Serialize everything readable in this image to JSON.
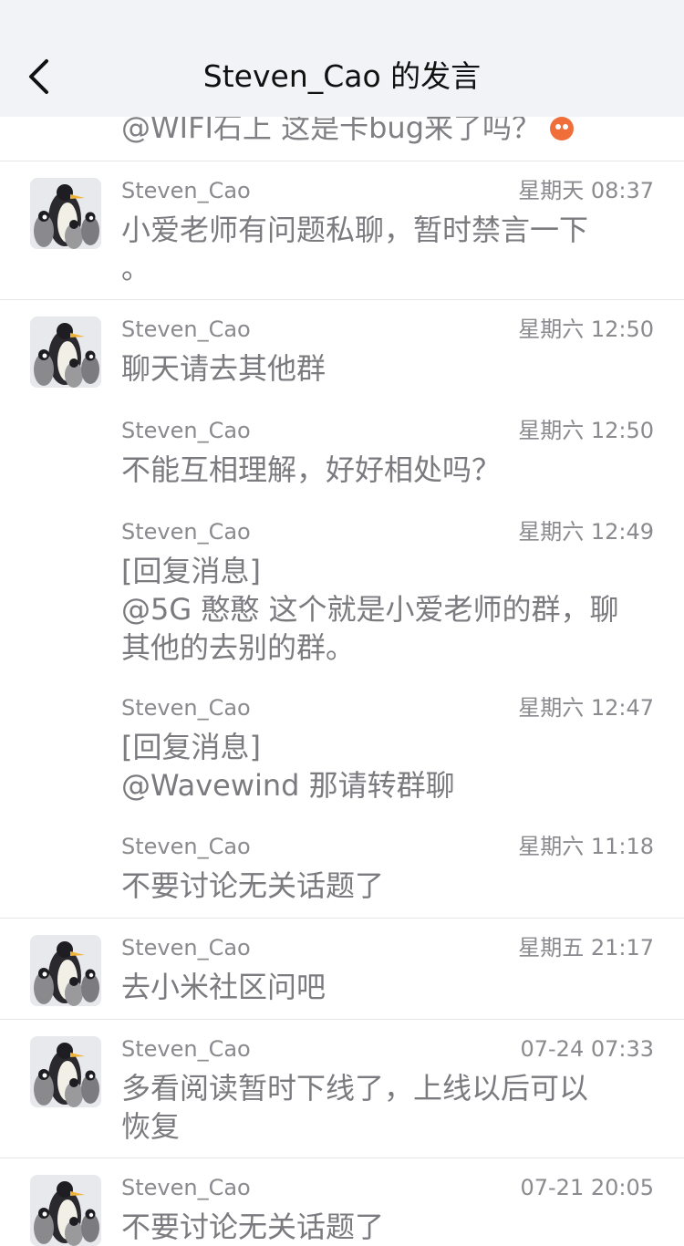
{
  "header": {
    "title": "Steven_Cao 的发言"
  },
  "partial_top": {
    "text": "@WIFI石上 这是卡bug来了吗？"
  },
  "messages": [
    {
      "name": "Steven_Cao",
      "time": "星期天 08:37",
      "text": "小爱老师有问题私聊，暂时禁言一下\n。"
    },
    {
      "name": "Steven_Cao",
      "time": "星期六 12:50",
      "text": "聊天请去其他群"
    },
    {
      "name": "Steven_Cao",
      "time": "星期六 12:50",
      "text": "不能互相理解，好好相处吗？"
    },
    {
      "name": "Steven_Cao",
      "time": "星期六 12:49",
      "text": "[回复消息]\n@5G 憨憨 这个就是小爱老师的群，聊\n其他的去别的群。"
    },
    {
      "name": "Steven_Cao",
      "time": "星期六 12:47",
      "text": "[回复消息]\n@Wavewind 那请转群聊"
    },
    {
      "name": "Steven_Cao",
      "time": "星期六 11:18",
      "text": "不要讨论无关话题了"
    },
    {
      "name": "Steven_Cao",
      "time": "星期五 21:17",
      "text": "去小米社区问吧"
    },
    {
      "name": "Steven_Cao",
      "time": "07-24 07:33",
      "text": "多看阅读暂时下线了，上线以后可以\n恢复"
    },
    {
      "name": "Steven_Cao",
      "time": "07-21 20:05",
      "text": "不要讨论无关话题了"
    }
  ],
  "icons": {
    "back": "chevron-left-icon",
    "avatar": "penguin-avatar",
    "emoji": "emoji-face-icon"
  },
  "colors": {
    "header_bg": "#f2f3f7",
    "title": "#111111",
    "meta_text": "#8a8a8f",
    "message_text": "#7a7a7f",
    "divider": "#e6e6ea"
  }
}
